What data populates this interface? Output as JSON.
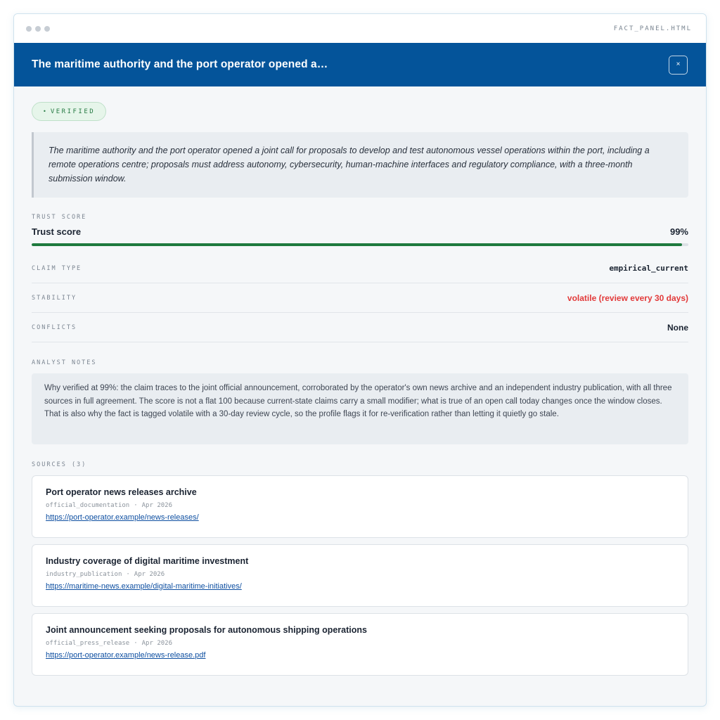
{
  "window": {
    "filename": "FACT_PANEL.HTML"
  },
  "header": {
    "title": "The maritime authority and the port operator opened a…",
    "close_label": "×"
  },
  "status": {
    "dot": "•",
    "label": "VERIFIED"
  },
  "claim": {
    "text": "The maritime authority and the port operator opened a joint call for proposals to develop and test autonomous vessel operations within the port, including a remote operations centre; proposals must address autonomy, cybersecurity, human-machine interfaces and regulatory compliance, with a three-month submission window."
  },
  "trust": {
    "section_label": "TRUST SCORE",
    "label": "Trust score",
    "value_text": "99%",
    "value": 0.99,
    "bar_color": "#1e7a3e"
  },
  "meta": {
    "claim_type_label": "CLAIM TYPE",
    "claim_type_value": "empirical_current",
    "stability_label": "STABILITY",
    "stability_value": "volatile (review every 30 days)",
    "stability_color": "#e23a3a",
    "conflicts_label": "CONFLICTS",
    "conflicts_value": "None"
  },
  "notes": {
    "label": "ANALYST NOTES",
    "text": "Why verified at 99%: the claim traces to the joint official announcement, corroborated by the operator's own news archive and an independent industry publication, with all three sources in full agreement. The score is not a flat 100 because current-state claims carry a small modifier; what is true of an open call today changes once the window closes. That is also why the fact is tagged volatile with a 30-day review cycle, so the profile flags it for re-verification rather than letting it quietly go stale."
  },
  "sources": {
    "label": "SOURCES (3)",
    "separator": "·",
    "items": [
      {
        "title": "Port operator news releases archive",
        "type": "official_documentation",
        "date": "Apr 2026",
        "url": "https://port-operator.example/news-releases/"
      },
      {
        "title": "Industry coverage of digital maritime investment",
        "type": "industry_publication",
        "date": "Apr 2026",
        "url": "https://maritime-news.example/digital-maritime-initiatives/"
      },
      {
        "title": "Joint announcement seeking proposals for autonomous shipping operations",
        "type": "official_press_release",
        "date": "Apr 2026",
        "url": "https://port-operator.example/news-release.pdf"
      }
    ]
  }
}
